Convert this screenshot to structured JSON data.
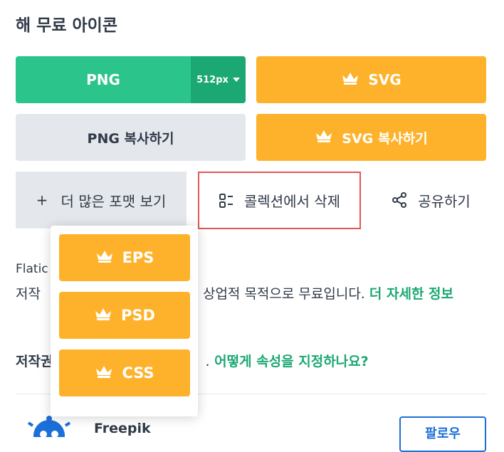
{
  "section_title": "해 무료 아이콘",
  "buttons": {
    "png_label": "PNG",
    "png_size": "512px",
    "svg_label": "SVG",
    "png_copy_label": "PNG 복사하기",
    "svg_copy_label": "SVG 복사하기"
  },
  "actions": {
    "more_formats_plus": "+",
    "more_formats_label": "더 많은 포맷 보기",
    "remove_collection_label": "콜렉션에서 삭제",
    "share_label": "공유하기"
  },
  "formats_dropdown": [
    "EPS",
    "PSD",
    "CSS"
  ],
  "license": {
    "line1": "Flatic",
    "line2_prefix": "저작",
    "line2_suffix": "상업적 목적으로 무료입니다.",
    "more_info_link": "더 자세한 정보"
  },
  "attribution": {
    "prefix": "저작권",
    "suffix": ".",
    "link": "어떻게 속성을 지정하나요?"
  },
  "author": {
    "name": "Freepik",
    "follow_label": "팔로우"
  },
  "colors": {
    "green": "#2bc48b",
    "orange": "#feb22b",
    "link_green": "#1ba872",
    "highlight_red": "#e2555b",
    "follow_blue": "#1b6fd8"
  }
}
